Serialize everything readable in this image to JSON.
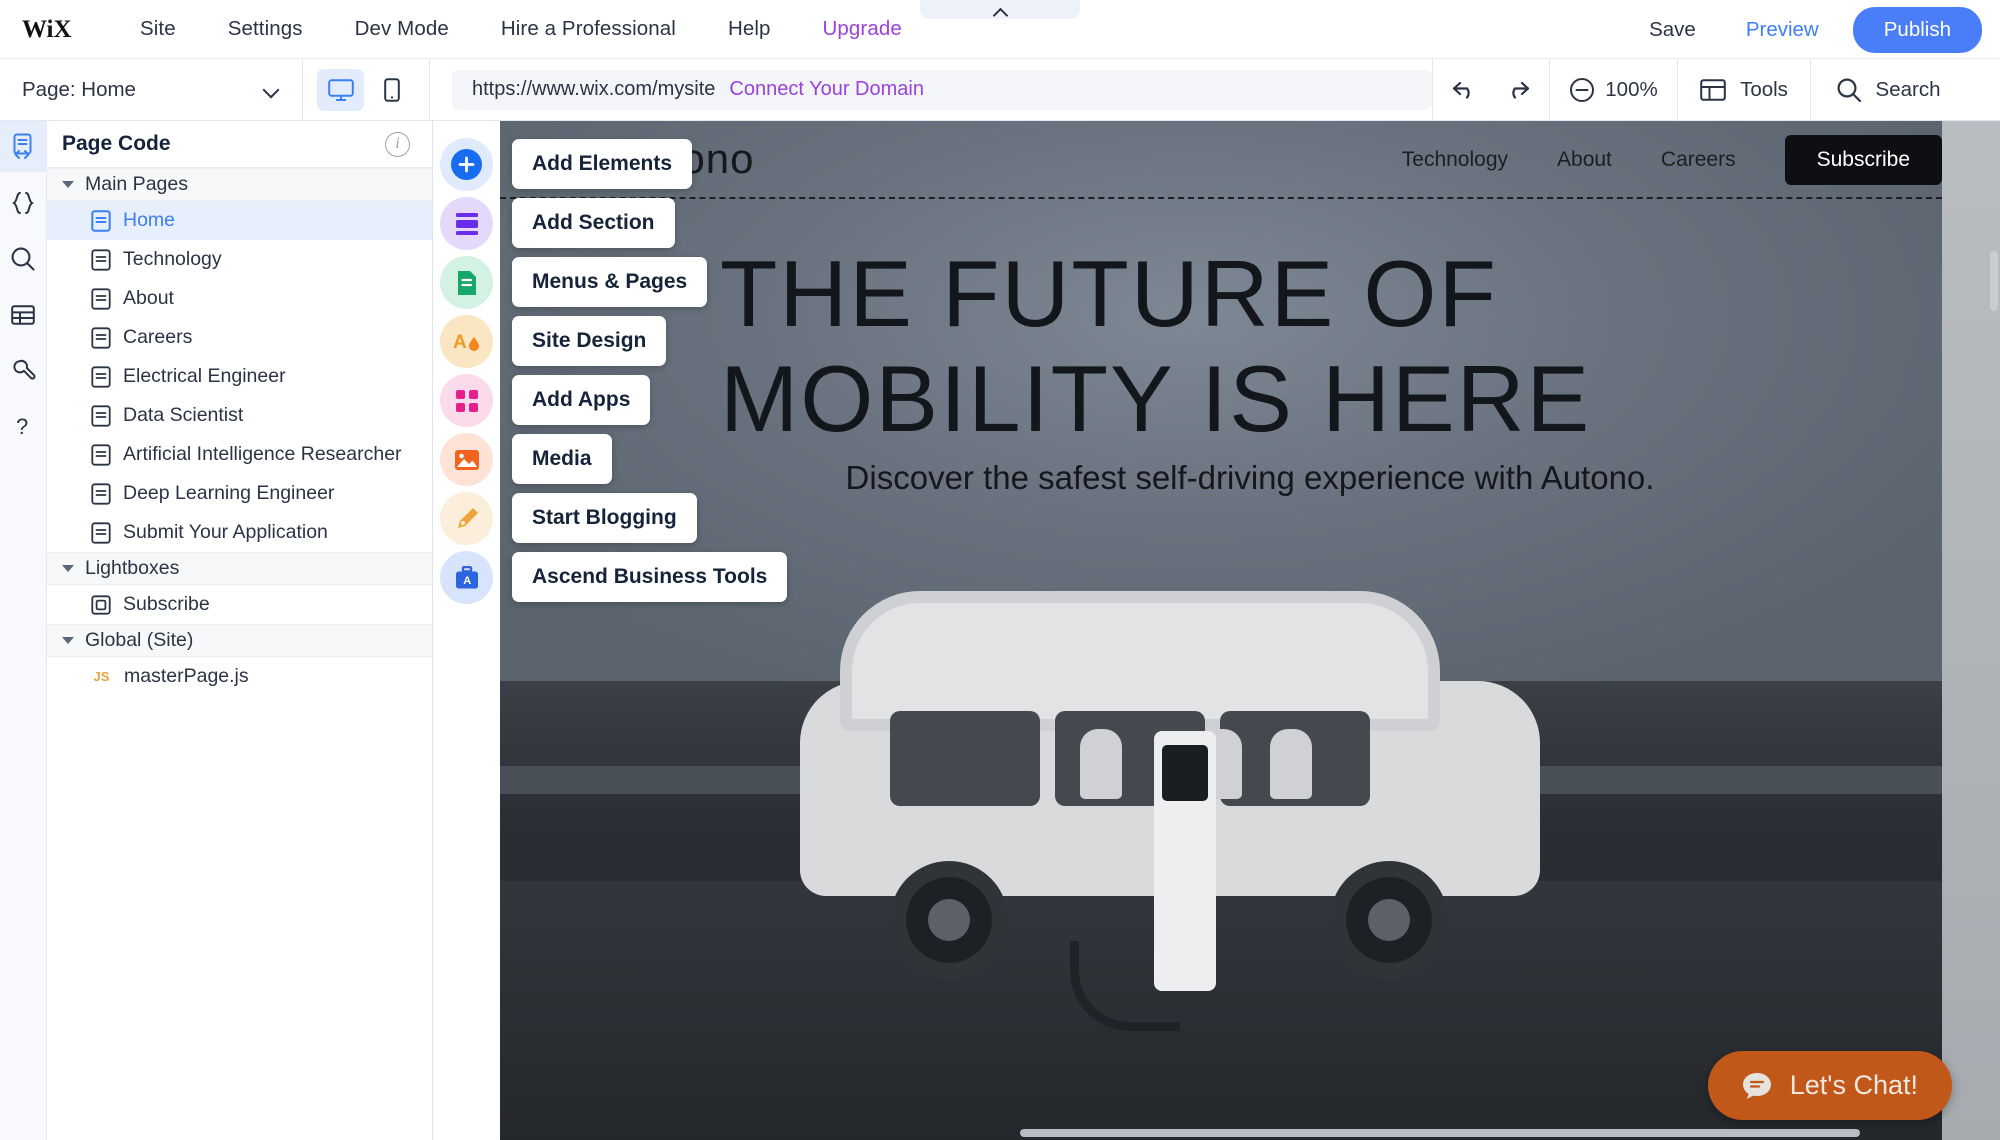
{
  "topbar": {
    "logo": "WiX",
    "nav": [
      {
        "label": "Site"
      },
      {
        "label": "Settings"
      },
      {
        "label": "Dev Mode"
      },
      {
        "label": "Hire a Professional"
      },
      {
        "label": "Help"
      },
      {
        "label": "Upgrade"
      }
    ],
    "save_label": "Save",
    "preview_label": "Preview",
    "publish_label": "Publish"
  },
  "toolbar": {
    "page_label": "Page: Home",
    "url": "https://www.wix.com/mysite",
    "connect_domain": "Connect Your Domain",
    "zoom": "100%",
    "tools_label": "Tools",
    "search_label": "Search"
  },
  "panel": {
    "title": "Page Code",
    "groups": [
      {
        "label": "Main Pages",
        "items": [
          {
            "label": "Home",
            "selected": true
          },
          {
            "label": "Technology",
            "selected": false
          },
          {
            "label": "About",
            "selected": false
          },
          {
            "label": "Careers",
            "selected": false
          },
          {
            "label": "Electrical Engineer",
            "selected": false
          },
          {
            "label": "Data Scientist",
            "selected": false
          },
          {
            "label": "Artificial Intelligence Researcher",
            "selected": false
          },
          {
            "label": "Deep Learning Engineer",
            "selected": false
          },
          {
            "label": "Submit Your Application",
            "selected": false
          }
        ]
      },
      {
        "label": "Lightboxes",
        "items": [
          {
            "label": "Subscribe",
            "selected": false
          }
        ]
      },
      {
        "label": "Global (Site)",
        "items": [
          {
            "label": "masterPage.js",
            "selected": false,
            "badge": "JS"
          }
        ]
      }
    ]
  },
  "rail": {
    "items": [
      {
        "name": "page-code-icon",
        "active": true
      },
      {
        "name": "code-braces-icon",
        "active": false
      },
      {
        "name": "search-icon",
        "active": false
      },
      {
        "name": "database-icon",
        "active": false
      },
      {
        "name": "tools-wrench-icon",
        "active": false
      },
      {
        "name": "help-icon",
        "active": false
      }
    ]
  },
  "tools": [
    {
      "label": "Add Elements",
      "icon": "plus-icon",
      "color": "#186cf0",
      "bg": "#dfeaff"
    },
    {
      "label": "Add Section",
      "icon": "section-icon",
      "color": "#6a2df0",
      "bg": "#e4d9fb"
    },
    {
      "label": "Menus & Pages",
      "icon": "pages-icon",
      "color": "#16a86a",
      "bg": "#d4f2e4"
    },
    {
      "label": "Site Design",
      "icon": "design-icon",
      "color": "#f09a25",
      "bg": "#fbe6c4"
    },
    {
      "label": "Add Apps",
      "icon": "apps-grid-icon",
      "color": "#e61f8c",
      "bg": "#fbdbeb"
    },
    {
      "label": "Media",
      "icon": "media-image-icon",
      "color": "#f4621f",
      "bg": "#fde3d5"
    },
    {
      "label": "Start Blogging",
      "icon": "blog-pen-icon",
      "color": "#f0a33a",
      "bg": "#fbeedb"
    },
    {
      "label": "Ascend Business Tools",
      "icon": "briefcase-icon",
      "color": "#2c63e0",
      "bg": "#d8e4fb"
    }
  ],
  "site": {
    "logo": "autono",
    "nav": [
      {
        "label": "Technology"
      },
      {
        "label": "About"
      },
      {
        "label": "Careers"
      }
    ],
    "subscribe_label": "Subscribe",
    "headline_line1": "THE FUTURE OF",
    "headline_line2": "MOBILITY IS HERE",
    "subheadline": "Discover the safest self-driving experience with Autono.",
    "chat_label": "Let's Chat!"
  },
  "colors": {
    "accent_blue": "#4a7ef8",
    "upgrade_purple": "#9a42db",
    "chat_orange": "#c2571a",
    "selected_row": "#e7eefc"
  }
}
